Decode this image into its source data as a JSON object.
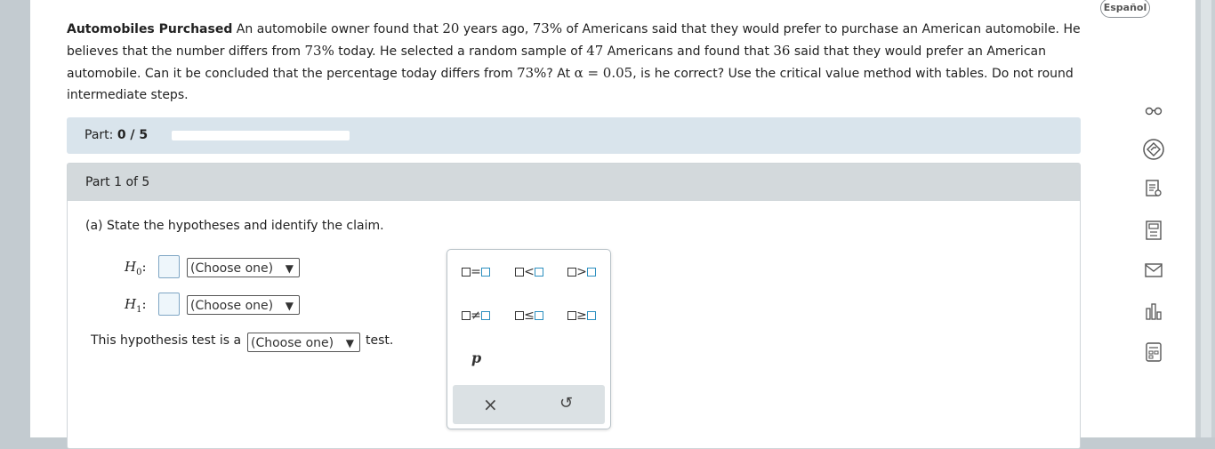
{
  "language_button": "Español",
  "problem": {
    "title": "Automobiles Purchased",
    "seg1": " An automobile owner found that ",
    "years": "20",
    "seg2": " years ago, ",
    "pct1": "73%",
    "seg3": " of Americans said that they would prefer to purchase an American automobile. He believes that the number differs from ",
    "pct2": "73%",
    "seg4": " today. He selected a random sample of ",
    "n": "47",
    "seg5": " Americans and found that ",
    "x": "36",
    "seg6": " said that they would prefer an American automobile. Can it be concluded that the percentage today differs from ",
    "pct3": "73%",
    "seg7": "? At ",
    "alpha": "α = 0.05",
    "seg8": ", is he correct? Use the critical value method with tables. Do not round intermediate steps."
  },
  "progress": {
    "label": "Part:",
    "value": "0 / 5",
    "fraction": 0.0
  },
  "part": {
    "header": "Part 1 of 5",
    "question": "(a) State the hypotheses and identify the claim.",
    "h0_label": "H",
    "h0_sub": "0",
    "h1_label": "H",
    "h1_sub": "1",
    "colon": ":",
    "choose": "(Choose one)",
    "arrow": "▼",
    "test_prefix": "This hypothesis test is a",
    "test_suffix": "test."
  },
  "palette": {
    "ops": [
      "=",
      "<",
      ">",
      "≠",
      "≤",
      "≥"
    ],
    "variable": "p",
    "clear_icon": "×",
    "undo_icon": "↺"
  },
  "side_icons": [
    "glasses-icon",
    "compass-icon",
    "notes-icon",
    "calculator-icon",
    "mail-icon",
    "chart-icon",
    "reference-icon"
  ],
  "colors": {
    "accent_blue": "#2c8fbf",
    "part_bar": "#d9e4ec",
    "section_header": "#d3d9dc"
  }
}
